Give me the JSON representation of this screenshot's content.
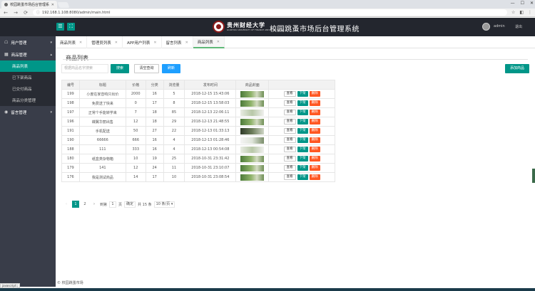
{
  "browser": {
    "tab_title": "校园跳蚤市场后台管理系",
    "url": "192.168.1.108:8080/admin/main.html"
  },
  "header": {
    "logo_calligraphy": "贵州财经大学",
    "logo_sub": "GUIZHOU UNIVERSITY OF FINANCE AND ECONOMICS",
    "system_title": "校园跳蚤市场后台管理系统",
    "username": "admin",
    "logout": "退出"
  },
  "sidebar": {
    "groups": [
      {
        "label": "用户管理"
      },
      {
        "label": "商品管理"
      },
      {
        "label": "留言管理"
      }
    ],
    "items": [
      {
        "label": "商品列表"
      },
      {
        "label": "已下架商品"
      },
      {
        "label": "已交付商品"
      },
      {
        "label": "商品分类管理"
      }
    ]
  },
  "tabs": [
    {
      "label": "商品列表"
    },
    {
      "label": "管理员列表"
    },
    {
      "label": "APP用户列表"
    },
    {
      "label": "留言列表"
    },
    {
      "label": "商品列表"
    }
  ],
  "main": {
    "section_title": "商品列表",
    "search_placeholder": "根据商品名字搜索",
    "search_btn": "搜索",
    "clear_btn": "清空查询",
    "refresh_btn": "刷新",
    "add_btn": "添加商品"
  },
  "table": {
    "headers": [
      "编号",
      "标题",
      "价格",
      "分类",
      "浏览量",
      "发布时间",
      "商品封面",
      ""
    ],
    "rows": [
      {
        "id": "199",
        "title": "小度在家音响只出价",
        "price": "2000",
        "cat": "16",
        "views": "5",
        "time": "2018-12-15 15:43:06",
        "thumb": "thumb-green"
      },
      {
        "id": "198",
        "title": "免费送了快来",
        "price": "0",
        "cat": "17",
        "views": "8",
        "time": "2018-12-15 13:58:03",
        "thumb": "thumb-green"
      },
      {
        "id": "197",
        "title": "正常个手能转学来",
        "price": "7",
        "cat": "18",
        "views": "85",
        "time": "2018-12-13 22:06:11",
        "thumb": "thumb-light"
      },
      {
        "id": "196",
        "title": "蝶翼华丽出售",
        "price": "12",
        "cat": "18",
        "views": "29",
        "time": "2018-12-13 21:48:55",
        "thumb": "thumb-green"
      },
      {
        "id": "191",
        "title": "手机配送",
        "price": "50",
        "cat": "27",
        "views": "22",
        "time": "2018-12-13 01:33:13",
        "thumb": "thumb-dark"
      },
      {
        "id": "190",
        "title": "66666",
        "price": "666",
        "cat": "16",
        "views": "4",
        "time": "2018-12-13 01:28:46",
        "thumb": "thumb-white"
      },
      {
        "id": "188",
        "title": "111",
        "price": "333",
        "cat": "16",
        "views": "4",
        "time": "2018-12-13 00:54:08",
        "thumb": "thumb-light"
      },
      {
        "id": "180",
        "title": "纸盒类杂物箱",
        "price": "10",
        "cat": "19",
        "views": "25",
        "time": "2018-10-31 23:31:42",
        "thumb": "thumb-green"
      },
      {
        "id": "179",
        "title": "141",
        "price": "12",
        "cat": "24",
        "views": "11",
        "time": "2018-10-31 23:10:07",
        "thumb": "thumb-green"
      },
      {
        "id": "176",
        "title": "我是测试商品",
        "price": "14",
        "cat": "17",
        "views": "10",
        "time": "2018-10-31 23:08:54",
        "thumb": "thumb-green"
      }
    ],
    "actions": {
      "view": "查看",
      "off": "下架",
      "del": "删除"
    }
  },
  "pager": {
    "prev": "‹",
    "current": "1",
    "page2": "2",
    "next": "›",
    "goto_label": "到第",
    "goto_value": "1",
    "page_unit": "页",
    "confirm": "确定",
    "total": "共 15 条",
    "per_page": "10 条/页"
  },
  "footer_text": "© 校园跳蚤市场",
  "status_url": "javascript:;"
}
